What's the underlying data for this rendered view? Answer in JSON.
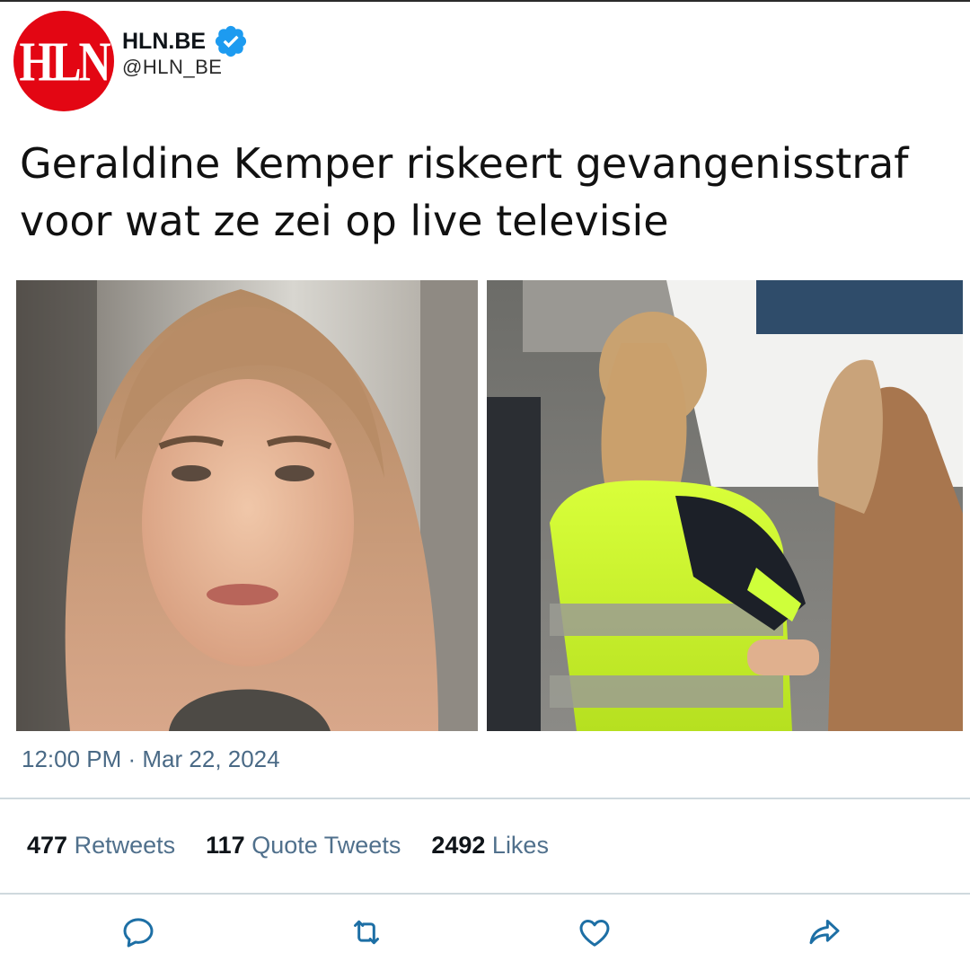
{
  "account": {
    "avatar_text": "HLN",
    "display_name": "HLN.BE",
    "handle": "@HLN_BE",
    "verified": true
  },
  "tweet": {
    "text_line1": "Geraldine Kemper riskeert gevangenisstraf",
    "text_line2": "voor wat ze zei op live televisie",
    "timestamp": "12:00 PM · Mar 22, 2024"
  },
  "stats": {
    "retweets_count": "477",
    "retweets_label": "Retweets",
    "quotes_count": "117",
    "quotes_label": "Quote Tweets",
    "likes_count": "2492",
    "likes_label": "Likes"
  },
  "icons": {
    "reply": "reply-icon",
    "retweet": "retweet-icon",
    "like": "heart-icon",
    "share": "share-icon"
  },
  "colors": {
    "brand_red": "#e30613",
    "verified_blue": "#1d9bf0",
    "icon_blue": "#1d6fa5",
    "label_gray": "#50708c"
  }
}
